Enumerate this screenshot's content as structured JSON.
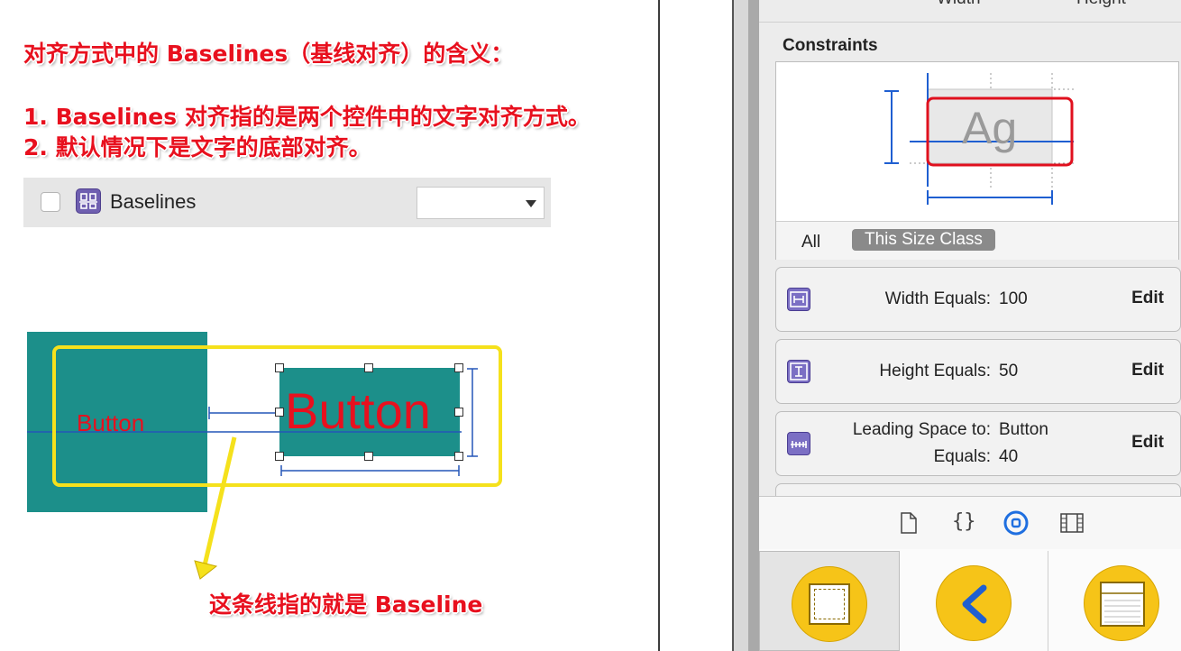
{
  "annotations": {
    "title": "对齐方式中的 Baselines（基线对齐）的含义：",
    "point1": "1. Baselines 对齐指的是两个控件中的文字对齐方式。",
    "point2": "2. 默认情况下是文字的底部对齐。",
    "arrow_caption": "这条线指的就是 Baseline"
  },
  "baselines_row": {
    "label": "Baselines",
    "checked": false,
    "dropdown_value": ""
  },
  "canvas_demo": {
    "small_button_label": "Button",
    "large_button_label": "Button"
  },
  "inspector": {
    "header_labels": [
      "Width",
      "Height"
    ],
    "section_title": "Constraints",
    "preview_glyph": "Ag",
    "size_class_tabs": [
      "All",
      "This Size Class"
    ],
    "constraints": [
      {
        "label": "Width Equals:",
        "value": "100",
        "action": "Edit",
        "icon": "width-constraint-icon"
      },
      {
        "label": "Height Equals:",
        "value": "50",
        "action": "Edit",
        "icon": "height-constraint-icon"
      },
      {
        "label": "Leading Space to:",
        "value": "Button",
        "label2": "Equals:",
        "value2": "40",
        "action": "Edit",
        "icon": "leading-space-icon"
      }
    ],
    "toolbar_icons": [
      "file-inspector-icon",
      "quick-help-icon",
      "object-library-icon",
      "media-library-icon"
    ],
    "library_items": [
      "view-icon",
      "back-button-icon",
      "table-view-icon"
    ]
  },
  "colors": {
    "annotation_red": "#e8101e",
    "teal": "#1c8f8a",
    "highlight_yellow": "#f5e11c",
    "constraint_blue": "#1f5fd1",
    "library_yellow": "#f6c418"
  }
}
